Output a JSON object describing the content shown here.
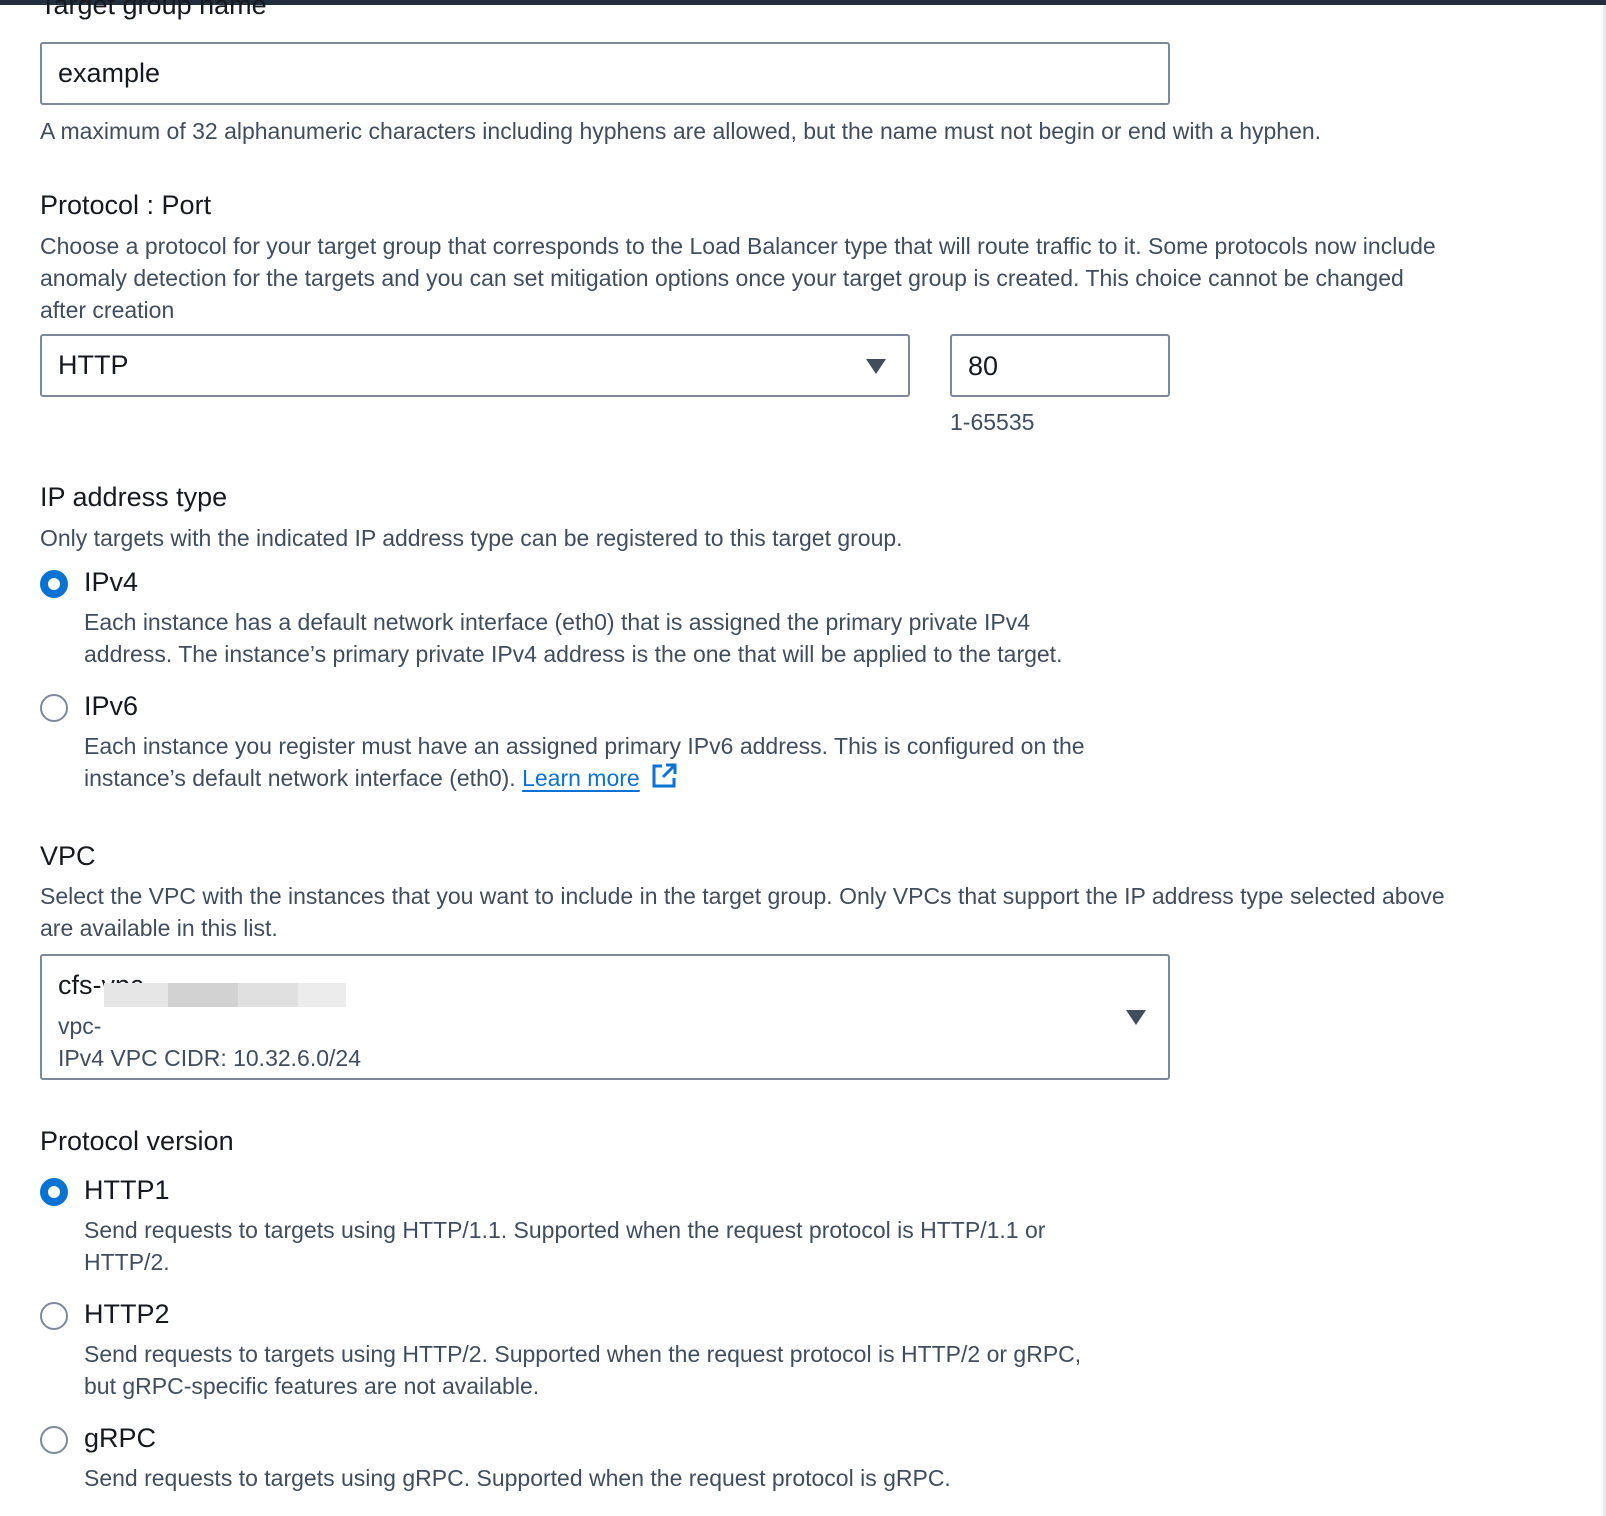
{
  "target_group_name": {
    "label": "Target group name",
    "value": "example",
    "hint": "A maximum of 32 alphanumeric characters including hyphens are allowed, but the name must not begin or end with a hyphen."
  },
  "protocol_port": {
    "label": "Protocol : Port",
    "description_line1": "Choose a protocol for your target group that corresponds to the Load Balancer type that will route traffic to it. Some protocols now include",
    "description_line2": "anomaly detection for the targets and you can set mitigation options once your target group is created. This choice cannot be changed",
    "description_line3": "after creation",
    "protocol_value": "HTTP",
    "port_value": "80",
    "port_hint": "1-65535"
  },
  "ip_address_type": {
    "label": "IP address type",
    "description": "Only targets with the indicated IP address type can be registered to this target group.",
    "options": [
      {
        "label": "IPv4",
        "checked": true,
        "desc_line1": "Each instance has a default network interface (eth0) that is assigned the primary private IPv4",
        "desc_line2": "address. The instance’s primary private IPv4 address is the one that will be applied to the target."
      },
      {
        "label": "IPv6",
        "checked": false,
        "desc_line1": "Each instance you register must have an assigned primary IPv6 address. This is configured on the",
        "desc_line2": "instance’s default network interface (eth0).",
        "link": "Learn more"
      }
    ]
  },
  "vpc": {
    "label": "VPC",
    "description_line1": "Select the VPC with the instances that you want to include in the target group. Only VPCs that support the IP address type selected above",
    "description_line2": "are available in this list.",
    "selected_name": "cfs-vpc",
    "selected_id_prefix": "vpc-",
    "selected_cidr": "IPv4 VPC CIDR: 10.32.6.0/24"
  },
  "protocol_version": {
    "label": "Protocol version",
    "options": [
      {
        "label": "HTTP1",
        "checked": true,
        "desc_line1": "Send requests to targets using HTTP/1.1. Supported when the request protocol is HTTP/1.1 or",
        "desc_line2": "HTTP/2."
      },
      {
        "label": "HTTP2",
        "checked": false,
        "desc_line1": "Send requests to targets using HTTP/2. Supported when the request protocol is HTTP/2 or gRPC,",
        "desc_line2": "but gRPC-specific features are not available."
      },
      {
        "label": "gRPC",
        "checked": false,
        "desc_line1": "Send requests to targets using gRPC. Supported when the request protocol is gRPC."
      }
    ]
  },
  "colors": {
    "accent": "#0972d3",
    "text": "#16191f",
    "secondary_text": "#414d5c",
    "border": "#7d8998"
  },
  "icons": {
    "dropdown": "caret-down-icon",
    "external_link": "external-link-icon"
  }
}
